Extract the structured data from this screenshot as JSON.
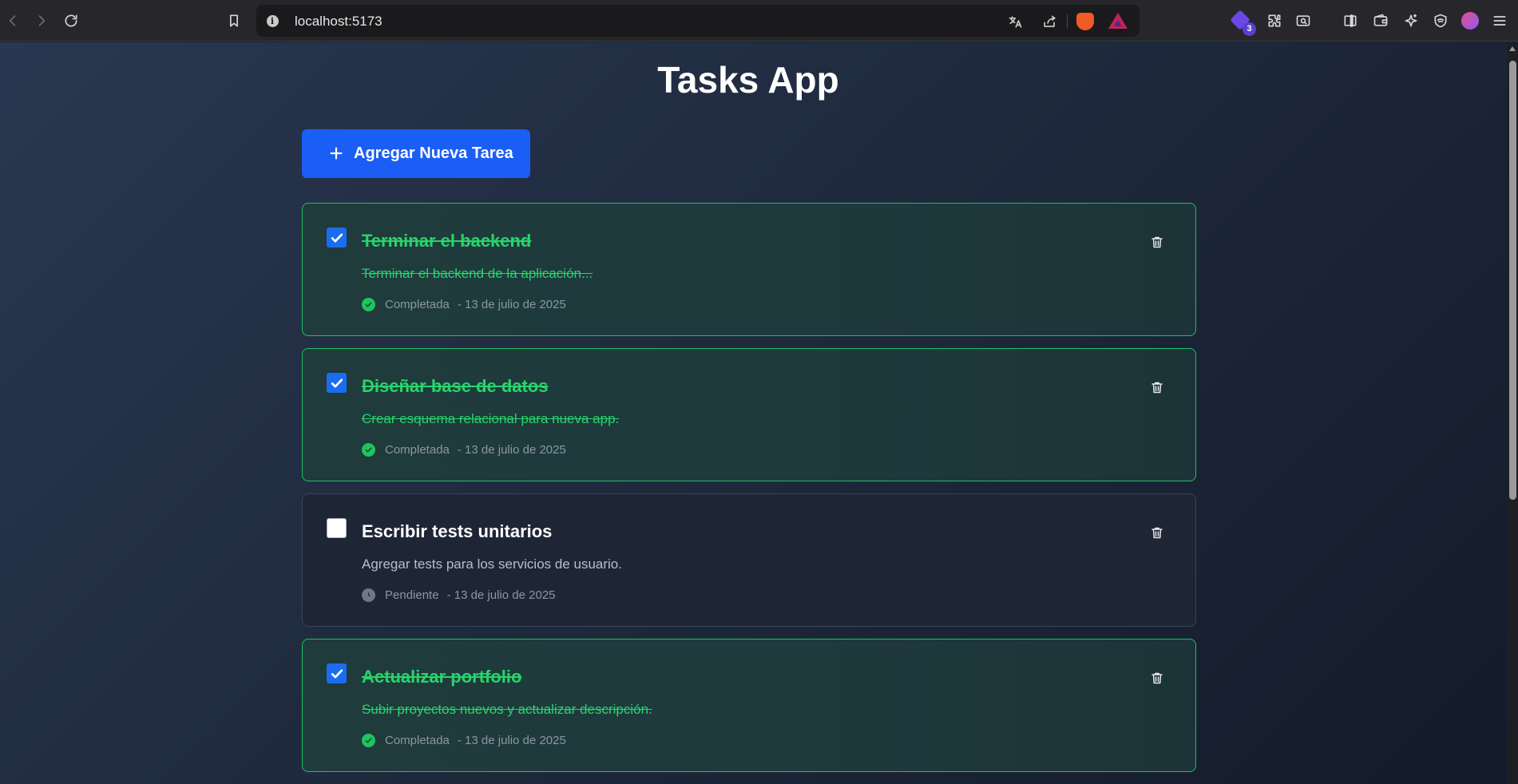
{
  "browser": {
    "url": "localhost:5173",
    "extension_badge_count": "3",
    "icons": [
      "back-icon",
      "forward-icon",
      "reload-icon",
      "bookmark-icon",
      "site-info-icon",
      "translate-icon",
      "share-icon",
      "brave-shields-icon",
      "brave-rewards-icon",
      "extension-gem-icon",
      "extensions-icon",
      "reader-mode-icon",
      "sidebar-icon",
      "wallet-icon",
      "leo-ai-icon",
      "vpn-icon",
      "profile-avatar",
      "menu-icon"
    ]
  },
  "app": {
    "title": "Tasks App",
    "add_button_label": "Agregar Nueva Tarea"
  },
  "tasks": [
    {
      "title": "Terminar el backend",
      "description": "Terminar el backend de la aplicación...",
      "status": "Completada",
      "date": "- 13 de julio de 2025",
      "completed": true
    },
    {
      "title": "Diseñar base de datos",
      "description": "Crear esquema relacional para nueva app.",
      "status": "Completada",
      "date": "- 13 de julio de 2025",
      "completed": true
    },
    {
      "title": "Escribir tests unitarios",
      "description": "Agregar tests para los servicios de usuario.",
      "status": "Pendiente",
      "date": "- 13 de julio de 2025",
      "completed": false
    },
    {
      "title": "Actualizar portfolio",
      "description": "Subir proyectos nuevos y actualizar descripción.",
      "status": "Completada",
      "date": "- 13 de julio de 2025",
      "completed": true
    }
  ],
  "colors": {
    "accent_blue": "#1a5ef5",
    "completed_green": "#28d36b",
    "completed_border": "#19c35e",
    "pending_text": "#b7bdc9"
  }
}
